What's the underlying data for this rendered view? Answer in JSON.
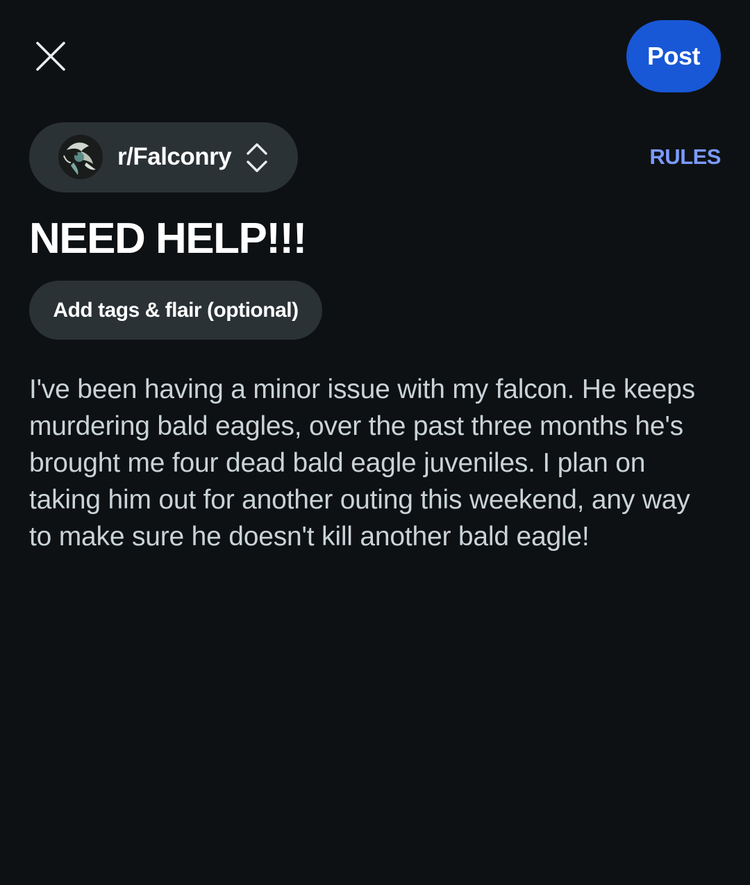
{
  "header": {
    "close_icon": "close-icon",
    "post_label": "Post",
    "post_color": "#1858d6"
  },
  "community": {
    "name": "r/Falconry",
    "avatar_icon": "community-avatar-falcon",
    "switch_icon": "chevron-up-down-icon"
  },
  "rules_label": "RULES",
  "rules_color": "#7b9bff",
  "post": {
    "title": "NEED HELP!!!",
    "flair_label": "Add tags & flair (optional)",
    "body": "I've been having a minor issue with my falcon. He keeps murdering bald eagles, over the past three months he's brought me four dead bald eagle juveniles. I plan on taking him out for another outing this weekend, any way to make sure he doesn't kill another bald eagle!"
  },
  "colors": {
    "background": "#0e1113",
    "chip_background": "#2a3236",
    "body_text": "#c9d3d8"
  }
}
